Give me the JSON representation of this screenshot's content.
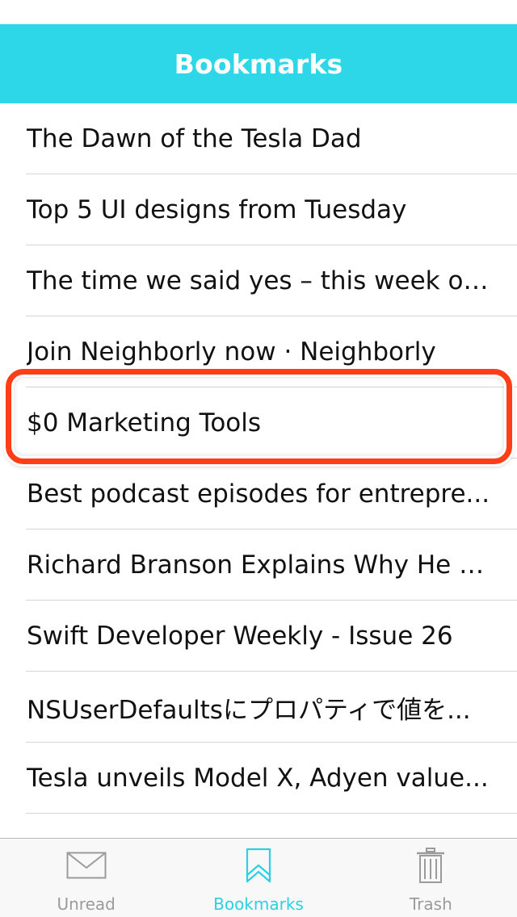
{
  "nav": {
    "title": "Bookmarks"
  },
  "bookmarks": [
    {
      "title": "The Dawn of the Tesla Dad"
    },
    {
      "title": "Top 5 UI designs from Tuesday"
    },
    {
      "title": "The time we said yes – this week on..."
    },
    {
      "title": "Join Neighborly now · Neighborly"
    },
    {
      "title": "$0 Marketing Tools"
    },
    {
      "title": "Best podcast episodes for entrepre..."
    },
    {
      "title": "Richard Branson Explains Why He C..."
    },
    {
      "title": "Swift Developer Weekly - Issue 26"
    },
    {
      "title": "NSUserDefaultsにプロパティで値を..."
    },
    {
      "title": "Tesla unveils Model X, Adyen value..."
    }
  ],
  "highlighted_index": 4,
  "tabs": [
    {
      "label": "Unread",
      "icon": "envelope-icon"
    },
    {
      "label": "Bookmarks",
      "icon": "bookmark-icon"
    },
    {
      "label": "Trash",
      "icon": "trash-icon"
    }
  ],
  "active_tab": "Bookmarks",
  "colors": {
    "accent": "#2dd7e8",
    "highlight": "#ff3d16",
    "inactive": "#9b9b9b"
  }
}
